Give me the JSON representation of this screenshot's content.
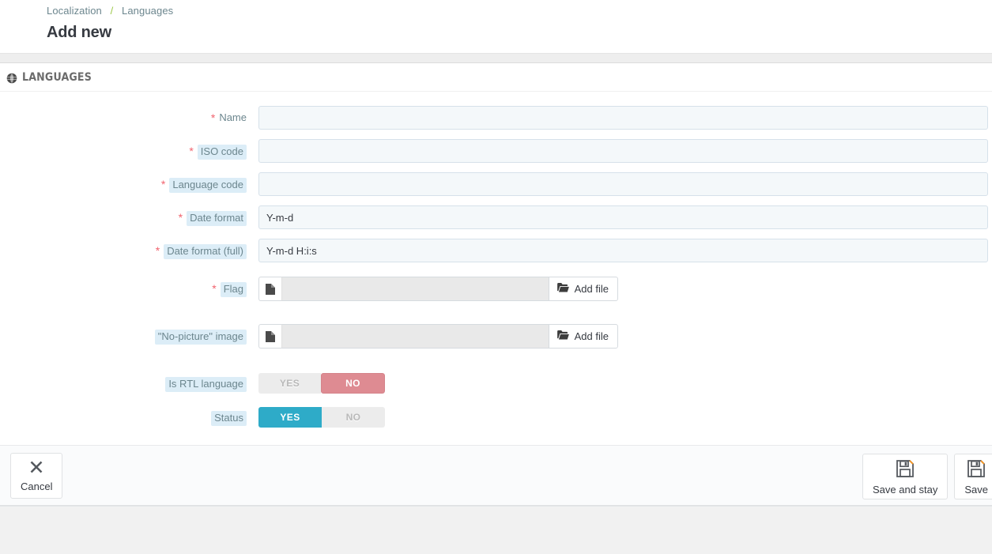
{
  "breadcrumb": {
    "parent": "Localization",
    "separator": "/",
    "current": "Languages"
  },
  "page_title": "Add new",
  "panel": {
    "icon": "globe-icon",
    "title": "LANGUAGES"
  },
  "form": {
    "required_marker": "*",
    "fields": [
      {
        "label": "Name",
        "required": true,
        "value": "",
        "placeholder": ""
      },
      {
        "label": "ISO code",
        "required": true,
        "value": "",
        "placeholder": ""
      },
      {
        "label": "Language code",
        "required": true,
        "value": "",
        "placeholder": ""
      },
      {
        "label": "Date format",
        "required": true,
        "value": "Y-m-d",
        "placeholder": ""
      },
      {
        "label": "Date format (full)",
        "required": true,
        "value": "Y-m-d H:i:s",
        "placeholder": ""
      }
    ],
    "file_fields": [
      {
        "label": "Flag",
        "required": true,
        "value": "",
        "button_label": "Add file",
        "button_icon": "folder-open-icon",
        "prefix_icon": "file-icon"
      },
      {
        "label": "\"No-picture\" image",
        "required": false,
        "value": "",
        "button_label": "Add file",
        "button_icon": "folder-open-icon",
        "prefix_icon": "file-icon"
      }
    ],
    "switches": [
      {
        "label": "Is RTL language",
        "yes_label": "YES",
        "no_label": "NO",
        "active": "NO"
      },
      {
        "label": "Status",
        "yes_label": "YES",
        "no_label": "NO",
        "active": "YES"
      }
    ]
  },
  "footer": {
    "cancel": {
      "label": "Cancel",
      "icon": "close-x-icon"
    },
    "save_and_stay": {
      "label": "Save and stay",
      "icon": "save-floppy-icon"
    },
    "save": {
      "label": "Save",
      "icon": "save-floppy-icon"
    }
  },
  "colors": {
    "accent_teal": "#2eabc8",
    "danger_red": "#de8b92",
    "required_star": "#f1636e",
    "label_pill_bg": "#dcedf7",
    "label_text": "#6c868e",
    "breadcrumb_sep": "#9ec94a",
    "input_bg": "#f4f8fa",
    "input_border": "#d6e1ea",
    "save_icon_accent": "#f7941e"
  }
}
